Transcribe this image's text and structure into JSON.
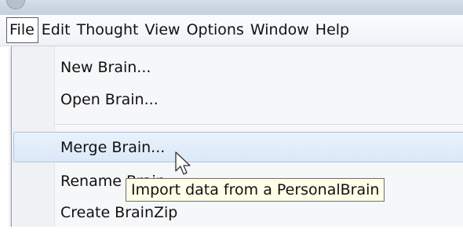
{
  "menubar": {
    "items": [
      "File",
      "Edit",
      "Thought",
      "View",
      "Options",
      "Window",
      "Help"
    ]
  },
  "file_menu": {
    "items": [
      "New Brain...",
      "Open Brain...",
      "Merge Brain...",
      "Rename Brain...",
      "Create BrainZip"
    ]
  },
  "tooltip": {
    "text": "Import data from a PersonalBrain"
  },
  "icons": {
    "cursor": "arrow-cursor-icon"
  }
}
